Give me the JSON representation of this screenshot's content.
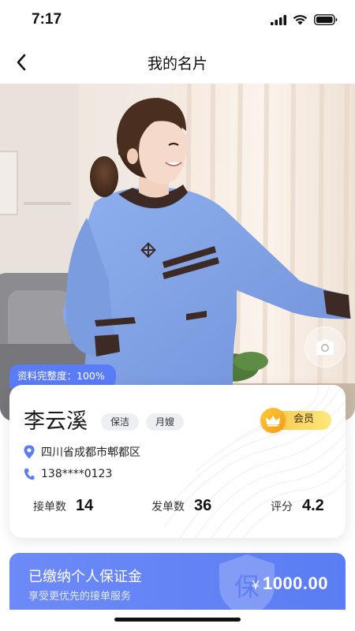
{
  "status_bar": {
    "time": "7:17"
  },
  "nav": {
    "title": "我的名片"
  },
  "profile": {
    "completion": "资料完整度：100%",
    "name": "李云溪",
    "tags": [
      "保洁",
      "月嫂"
    ],
    "member_label": "会员",
    "address": "四川省成都市郫都区",
    "phone": "138****0123",
    "stats": [
      {
        "label": "接单数",
        "value": "14"
      },
      {
        "label": "发单数",
        "value": "36"
      },
      {
        "label": "评分",
        "value": "4.2"
      }
    ]
  },
  "deposit": {
    "title": "已缴纳个人保证金",
    "subtitle": "享受更优先的接单服务",
    "currency": "¥",
    "amount": "1000.00",
    "watermark_char": "保"
  },
  "colors": {
    "accent": "#5b7cf7",
    "member_gold": "#f7c64a",
    "uniform_blue": "#7d9ee4"
  },
  "icons": {
    "back": "chevron-left-icon",
    "camera": "camera-icon",
    "location": "location-pin-icon",
    "phone": "phone-icon",
    "crown": "crown-icon",
    "shield": "shield-icon"
  }
}
